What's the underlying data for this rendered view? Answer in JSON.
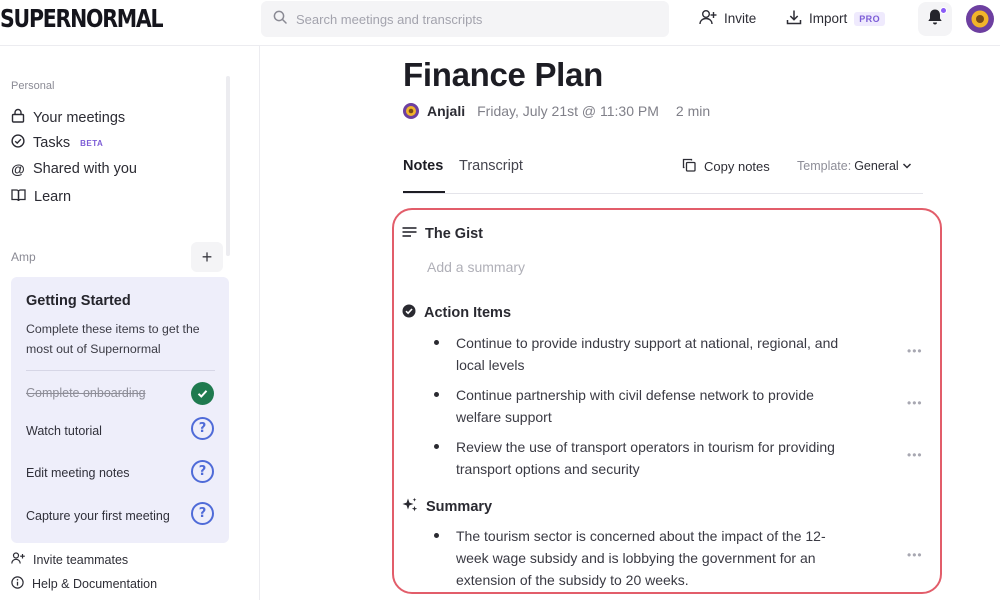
{
  "app": {
    "logo": "SUPERNORMAL"
  },
  "search": {
    "placeholder": "Search meetings and transcripts"
  },
  "header": {
    "invite_label": "Invite",
    "import_label": "Import",
    "pro_badge": "PRO"
  },
  "sidebar": {
    "personal_label": "Personal",
    "items": [
      {
        "label": "Your meetings",
        "icon": "lock-icon"
      },
      {
        "label": "Tasks",
        "badge": "BETA",
        "icon": "check-circle-icon"
      },
      {
        "label": "Shared with you",
        "icon": "at-icon"
      },
      {
        "label": "Learn",
        "icon": "book-icon"
      }
    ],
    "workspace_label": "Amp",
    "getting_started": {
      "title": "Getting Started",
      "description": "Complete these items to get the most out of Supernormal",
      "tasks": [
        {
          "label": "Complete onboarding",
          "done": true
        },
        {
          "label": "Watch tutorial",
          "done": false
        },
        {
          "label": "Edit meeting notes",
          "done": false
        },
        {
          "label": "Capture your first meeting",
          "done": false
        }
      ]
    },
    "footer": [
      {
        "label": "Invite teammates"
      },
      {
        "label": "Help & Documentation"
      }
    ]
  },
  "meeting": {
    "title": "Finance Plan",
    "author": "Anjali",
    "date": "Friday, July 21st @ 11:30 PM",
    "duration": "2 min"
  },
  "tabs": [
    {
      "label": "Notes",
      "active": true
    },
    {
      "label": "Transcript",
      "active": false
    }
  ],
  "toolbar": {
    "copy_notes": "Copy notes",
    "template_label": "Template:",
    "template_value": "General"
  },
  "notes": {
    "gist_heading": "The Gist",
    "gist_placeholder": "Add a summary",
    "action_heading": "Action Items",
    "action_items": [
      "Continue to provide industry support at national, regional, and local levels",
      "Continue partnership with civil defense network to provide welfare support",
      "Review the use of transport operators in tourism for providing transport options and security"
    ],
    "summary_heading": "Summary",
    "summary_items": [
      "The tourism sector is concerned about the impact of the 12-week wage subsidy and is lobbying the government for an extension of the subsidy to 20 weeks."
    ]
  },
  "colors": {
    "accent": "#7c5cd6",
    "highlight": "#e25d6a",
    "success": "#1f7a4f",
    "help": "#4f6bd8"
  }
}
